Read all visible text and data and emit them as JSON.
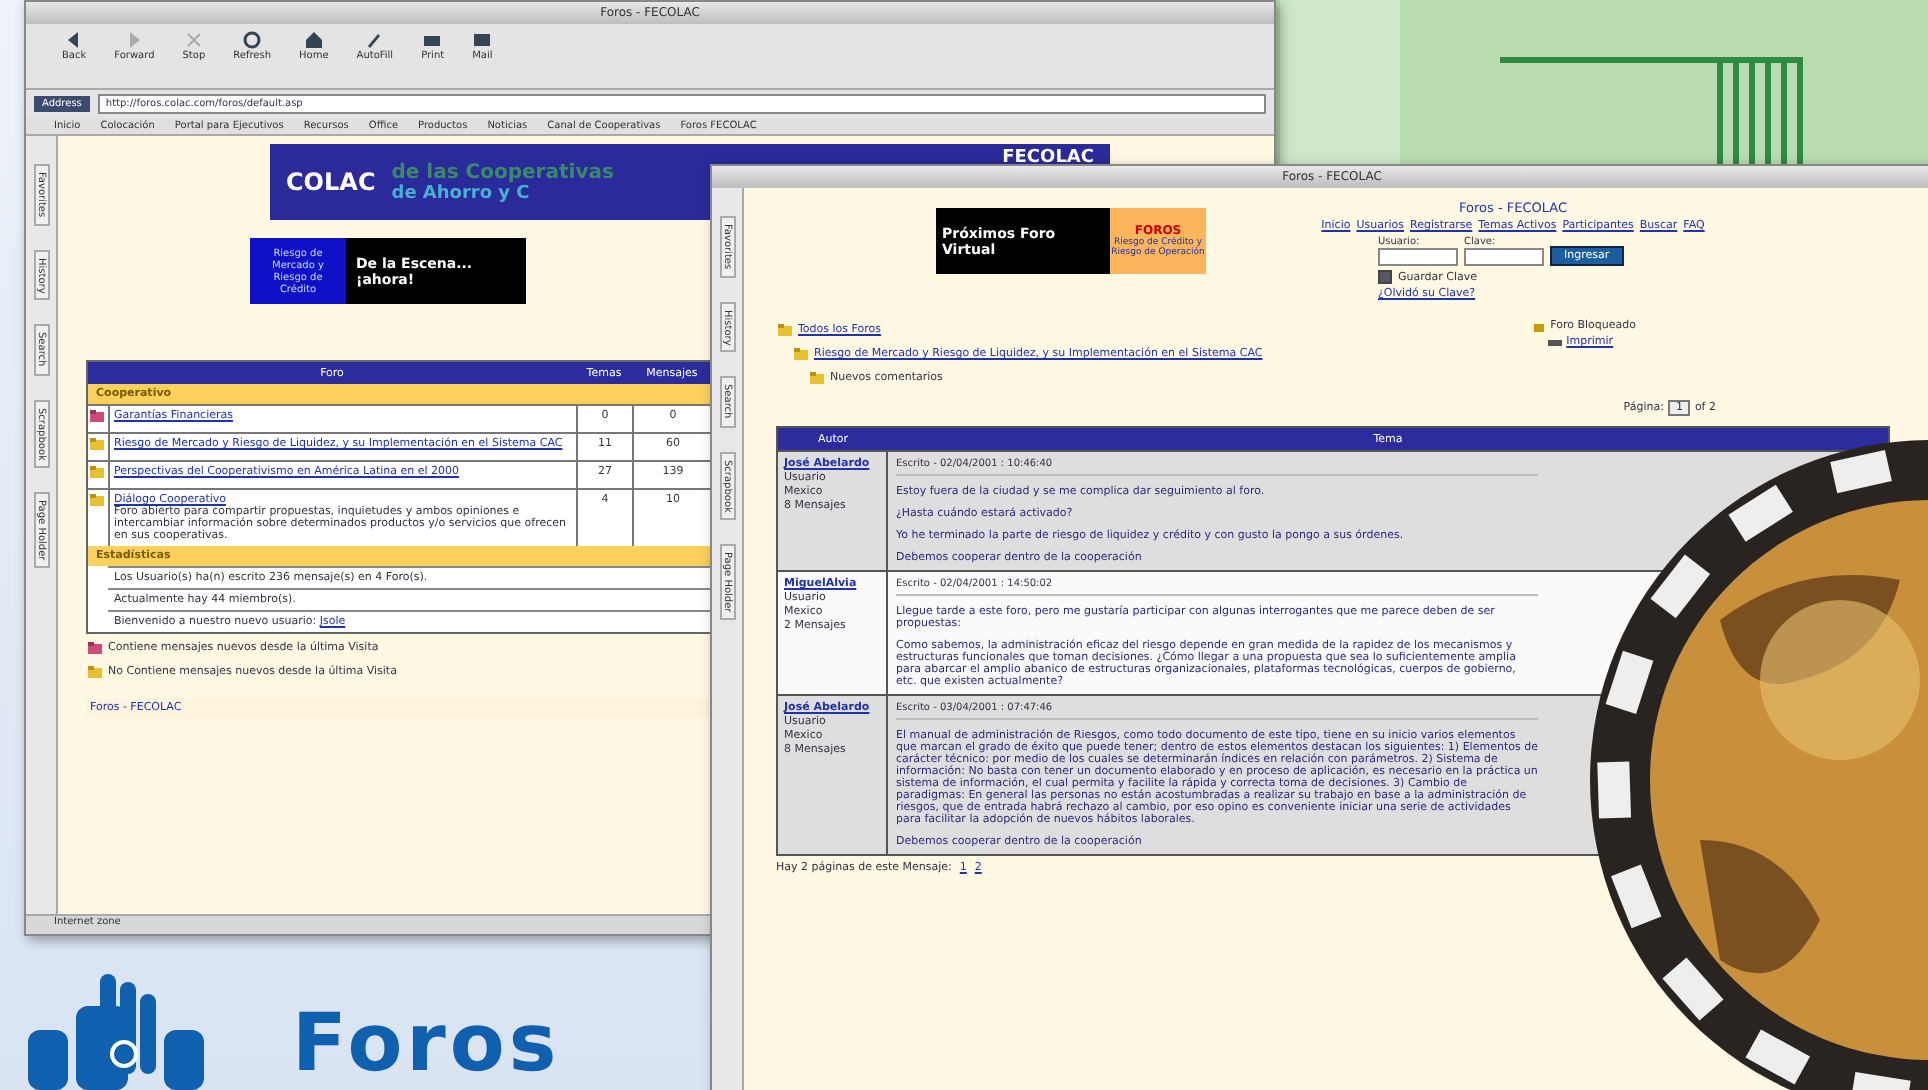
{
  "back_window": {
    "title": "Foros - FECOLAC",
    "toolbar": [
      "Back",
      "Forward",
      "Stop",
      "Refresh",
      "Home",
      "AutoFill",
      "Print",
      "Mail"
    ],
    "address_label": "Address",
    "url": "http://foros.colac.com/foros/default.asp",
    "favorites": [
      "Inicio",
      "Colocación",
      "Portal para Ejecutivos",
      "Recursos",
      "Office",
      "Productos",
      "Noticias",
      "Canal de Cooperativas",
      "Foros FECOLAC"
    ],
    "side_tabs": [
      "Favorites",
      "History",
      "Search",
      "Scrapbook",
      "Page Holder"
    ],
    "banner": {
      "name": "COLAC",
      "tagline": "de las Cooperativas",
      "subline": "de Ahorro y C",
      "brand": "FECOLAC"
    },
    "promo": {
      "left": "Riesgo de Mercado y Riesgo de Crédito",
      "right": "De la Escena... ¡ahora!"
    },
    "table": {
      "columns": [
        "Foro",
        "Temas",
        "Mensajes"
      ],
      "category": "Cooperativo",
      "rows": [
        {
          "name": "Garantías Financieras",
          "topics": "0",
          "posts": "0",
          "new_posts": true
        },
        {
          "name": "Riesgo de Mercado y Riesgo de Liquidez, y su Implementación en el Sistema CAC",
          "topics": "11",
          "posts": "60",
          "new_posts": false
        },
        {
          "name": "Perspectivas del Cooperativismo en América Latina en el 2000",
          "topics": "27",
          "posts": "139",
          "new_posts": false
        },
        {
          "name": "Diálogo Cooperativo",
          "description": "Foro abierto para compartir propuestas, inquietudes y ambos opiniones e intercambiar información sobre determinados productos y/o servicios que ofrecen en sus cooperativas.",
          "topics": "4",
          "posts": "10",
          "new_posts": false
        }
      ],
      "stats_title": "Estadísticas",
      "stats": [
        "Los Usuario(s) ha(n) escrito 236 mensaje(s) en 4 Foro(s).",
        "Actualmente hay 44 miembro(s).",
        "Bienvenido a nuestro nuevo usuario:"
      ],
      "new_member": "Jsole"
    },
    "legend": [
      {
        "text": "Contiene mensajes nuevos desde la última Visita",
        "new_posts": true
      },
      {
        "text": "No Contiene mensajes nuevos desde la última Visita",
        "new_posts": false
      }
    ],
    "footer": "Foros - FECOLAC",
    "status": "Internet zone"
  },
  "front_window": {
    "title": "Foros - FECOLAC",
    "side_tabs": [
      "Favorites",
      "History",
      "Search",
      "Scrapbook",
      "Page Holder"
    ],
    "promo": {
      "left": "Próximos Foro Virtual",
      "badge": "FOROS",
      "right": "Riesgo de Crédito y Riesgo de Operación"
    },
    "site_title": "Foros - FECOLAC",
    "nav": [
      "Inicio",
      "Usuarios",
      "Registrarse",
      "Temas Activos",
      "Participantes",
      "Buscar",
      "FAQ"
    ],
    "login": {
      "user_label": "Usuario:",
      "password_label": "Clave:",
      "button": "Ingresar",
      "remember": "Guardar Clave",
      "remember_checked": true,
      "forgot": "¿Olvidó su Clave?"
    },
    "breadcrumb": [
      {
        "text": "Todos los Foros",
        "link": true
      },
      {
        "text": "Riesgo de Mercado y Riesgo de Liquidez, y su Implementación en el Sistema CAC",
        "link": true
      },
      {
        "text": "Nuevos comentarios",
        "link": false
      }
    ],
    "locked": "Foro Bloqueado",
    "print": "Imprimir",
    "pager": {
      "label": "Página:",
      "value": "1",
      "of": "of 2"
    },
    "columns": [
      "Autor",
      "Tema"
    ],
    "posts": [
      {
        "author": "José Abelardo",
        "role": "Usuario",
        "country": "Mexico",
        "count": "8 Mensajes",
        "meta": "Escrito - 02/04/2001 : 10:46:40",
        "paragraphs": [
          "Estoy fuera de la ciudad y se me complica dar seguimiento al foro.",
          "¿Hasta cuándo estará activado?",
          "Yo he terminado la parte de riesgo de liquidez y crédito y con gusto la pongo a sus órdenes.",
          "Debemos cooperar dentro de la cooperación"
        ]
      },
      {
        "author": "MiguelAlvia",
        "role": "Usuario",
        "country": "Mexico",
        "count": "2 Mensajes",
        "meta": "Escrito - 02/04/2001 : 14:50:02",
        "paragraphs": [
          "Llegue tarde a este foro, pero me gustaría participar con algunas interrogantes que me parece deben de ser propuestas:",
          "Como sabemos, la administración eficaz del riesgo depende en gran medida de la rapidez de los mecanismos y estructuras funcionales que toman decisiones. ¿Cómo llegar a una propuesta que sea lo suficientemente amplia para abarcar el amplio abanico de estructuras organizacionales, plataformas tecnológicas, cuerpos de gobierno, etc. que existen actualmente?"
        ]
      },
      {
        "author": "José Abelardo",
        "role": "Usuario",
        "country": "Mexico",
        "count": "8 Mensajes",
        "meta": "Escrito - 03/04/2001 : 07:47:46",
        "paragraphs": [
          "El manual de administración de Riesgos, como todo documento de este tipo, tiene en su inicio varios elementos que marcan el grado de éxito que puede tener; dentro de estos elementos destacan los siguientes: 1) Elementos de carácter técnico: por medio de los cuales se determinarán índices en relación con parámetros. 2) Sistema de información: No basta con tener un documento elaborado y en proceso de aplicación, es necesario en la práctica un sistema de información, el cual permita y facilite la rápida y correcta toma de decisiones. 3) Cambio de paradigmas: En general las personas no están acostumbradas a realizar su trabajo en base a la administración de riesgos, que de entrada habrá rechazo al cambio, por eso opino es conveniente iniciar una serie de actividades para facilitar la adopción de nuevos hábitos laborales.",
          "Debemos cooperar dentro de la cooperación"
        ]
      }
    ],
    "pages_note": "Hay 2 páginas de este Mensaje:",
    "pages": [
      "1",
      "2"
    ]
  },
  "logo": {
    "text": "Foros"
  }
}
